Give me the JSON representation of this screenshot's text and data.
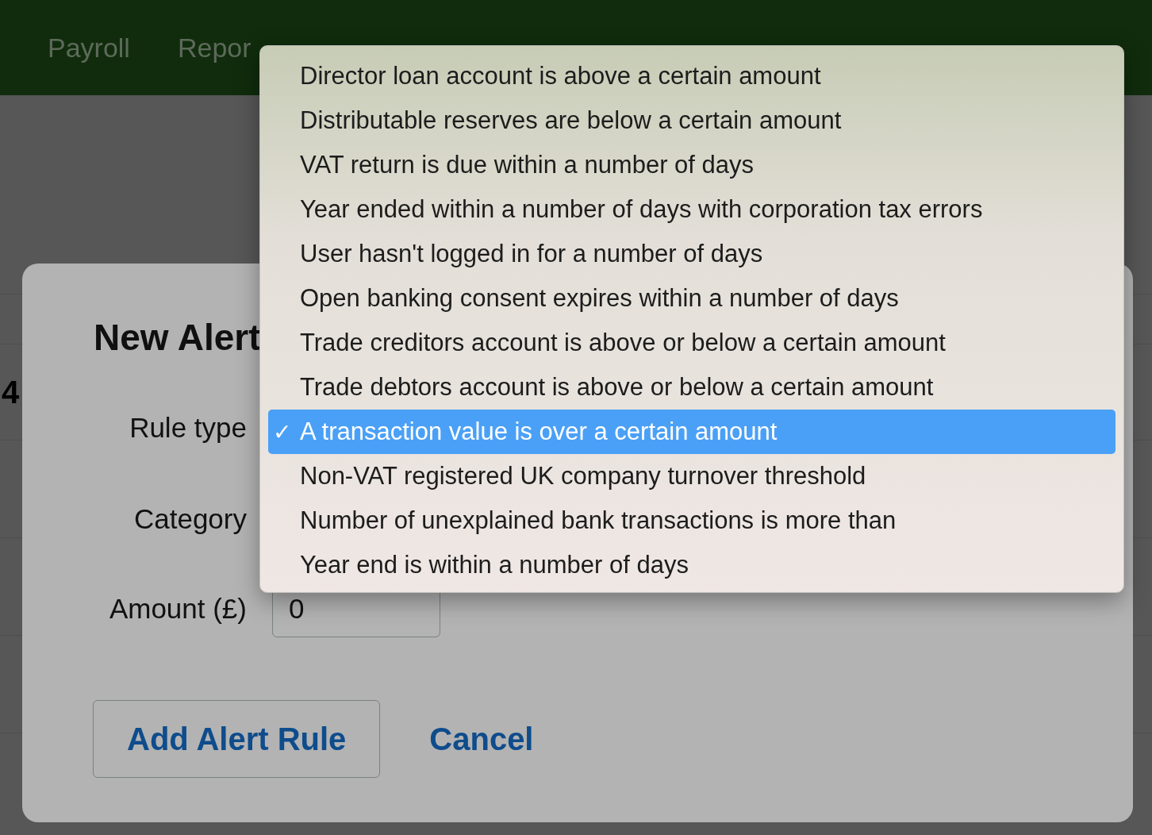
{
  "nav": {
    "items": [
      {
        "label": "Payroll"
      },
      {
        "label": "Repor"
      }
    ]
  },
  "background_text": "4",
  "modal": {
    "title": "New Alert",
    "fields": [
      {
        "label": "Rule type",
        "kind": "select"
      },
      {
        "label": "Category",
        "kind": "select"
      },
      {
        "label": "Amount (£)",
        "kind": "input",
        "value": "0"
      }
    ],
    "buttons": [
      {
        "label": "Add Alert Rule",
        "kind": "outlined"
      },
      {
        "label": "Cancel",
        "kind": "link"
      }
    ]
  },
  "dropdown": {
    "check_mark": "✓",
    "options": [
      {
        "label": "Director loan account is above a certain amount",
        "selected": false
      },
      {
        "label": "Distributable reserves are below a certain amount",
        "selected": false
      },
      {
        "label": "VAT return is due within a number of days",
        "selected": false
      },
      {
        "label": "Year ended within a number of days with corporation tax errors",
        "selected": false
      },
      {
        "label": "User hasn't logged in for a number of days",
        "selected": false
      },
      {
        "label": "Open banking consent expires within a number of days",
        "selected": false
      },
      {
        "label": "Trade creditors account is above or below a certain amount",
        "selected": false
      },
      {
        "label": "Trade debtors account is above or below a certain amount",
        "selected": false
      },
      {
        "label": "A transaction value is over a certain amount",
        "selected": true
      },
      {
        "label": "Non-VAT registered UK company turnover threshold",
        "selected": false
      },
      {
        "label": "Number of unexplained bank transactions is more than",
        "selected": false
      },
      {
        "label": "Year end is within a number of days",
        "selected": false
      }
    ]
  }
}
